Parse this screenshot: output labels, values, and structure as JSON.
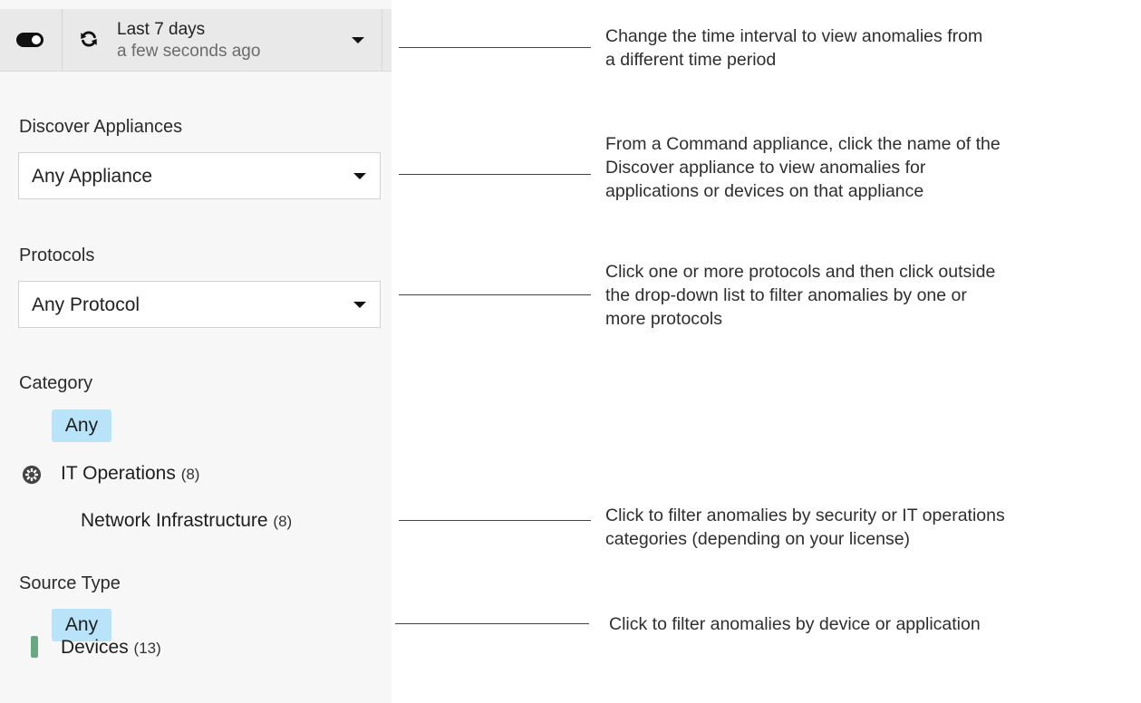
{
  "header": {
    "time_range_label": "Last 7 days",
    "last_refreshed": "a few seconds ago"
  },
  "filters": {
    "discover_appliances": {
      "label": "Discover Appliances",
      "selected": "Any Appliance"
    },
    "protocols": {
      "label": "Protocols",
      "selected": "Any Protocol"
    },
    "category": {
      "label": "Category",
      "any_label": "Any",
      "items": [
        {
          "label": "IT Operations",
          "count": "(8)"
        },
        {
          "label": "Network Infrastructure",
          "count": "(8)"
        }
      ]
    },
    "source_type": {
      "label": "Source Type",
      "any_label": "Any",
      "items": [
        {
          "label": "Devices",
          "count": "(13)"
        }
      ]
    }
  },
  "callouts": {
    "time_interval": [
      "Change the time interval to view anomalies from",
      "a different time period"
    ],
    "appliance": [
      "From a Command appliance, click the name of the",
      "Discover appliance to view anomalies for",
      "applications or devices on that appliance"
    ],
    "protocols": [
      "Click one or more protocols and then click outside",
      "the drop-down list to filter anomalies by one or",
      "more protocols"
    ],
    "category": [
      "Click to filter anomalies by security or IT operations",
      "categories (depending on your license)"
    ],
    "source_type": [
      "Click to filter anomalies by device or application"
    ]
  },
  "colors": {
    "panel_bg": "#f7f7f7",
    "topbar_bg": "#e9e9e9",
    "pill_bg": "#b9e3f9",
    "device_indicator": "#6aa884"
  },
  "icons": [
    "toggle-icon",
    "refresh-icon",
    "chevron-down-icon",
    "gear-icon",
    "device-indicator-icon"
  ]
}
